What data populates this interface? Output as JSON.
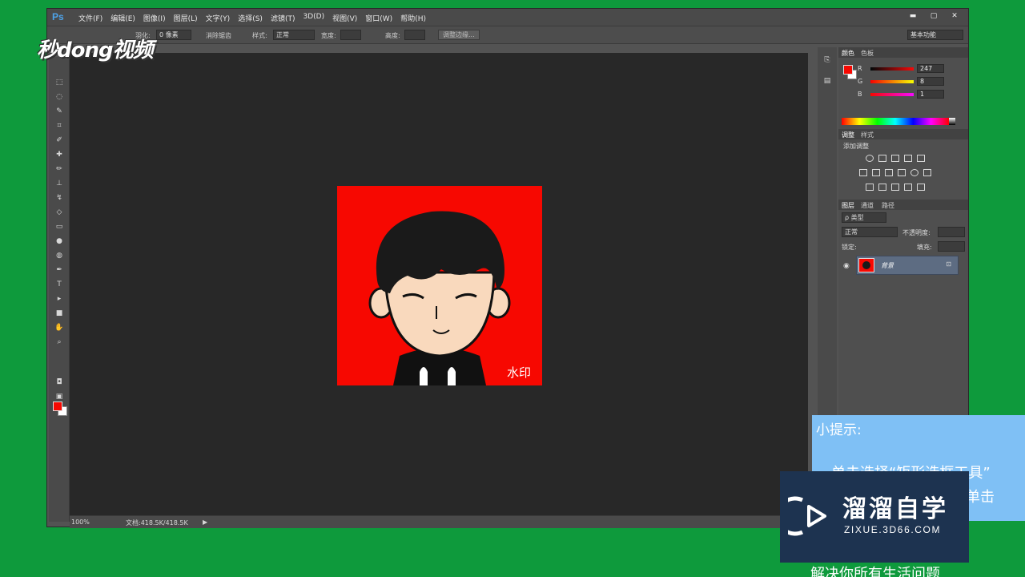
{
  "app": {
    "logo": "Ps"
  },
  "menu": [
    "文件(F)",
    "编辑(E)",
    "图像(I)",
    "图层(L)",
    "文字(Y)",
    "选择(S)",
    "滤镜(T)",
    "3D(D)",
    "视图(V)",
    "窗口(W)",
    "帮助(H)"
  ],
  "window_controls": {
    "minimize": "▬",
    "restore": "▢",
    "close": "✕"
  },
  "options_bar": {
    "feather_label": "羽化:",
    "feather_value": "0 像素",
    "antialias_label": "消除锯齿",
    "style_label": "样式:",
    "style_value": "正常",
    "width_label": "宽度:",
    "height_label": "高度:",
    "refine_edge_button": "调整边缘...",
    "workspace": "基本功能"
  },
  "status": {
    "zoom": "100%",
    "doc_info": "文档:418.5K/418.5K"
  },
  "canvas": {
    "watermark_text": "水印",
    "background_color": "#f70801"
  },
  "color_panel": {
    "tabs": [
      "颜色",
      "色板"
    ],
    "r_label": "R",
    "r_value": "247",
    "g_label": "G",
    "g_value": "8",
    "b_label": "B",
    "b_value": "1"
  },
  "adjust_panel": {
    "tabs": [
      "调整",
      "样式"
    ],
    "add_label": "添加调整"
  },
  "layers_panel": {
    "tabs": [
      "图层",
      "通道",
      "路径"
    ],
    "filter_label": "ρ 类型",
    "blend_mode": "正常",
    "opacity_label": "不透明度:",
    "lock_label": "锁定:",
    "fill_label": "填充:",
    "layer_name": "背景"
  },
  "overlay": {
    "logo_text": "秒dong视频",
    "tip_title": "小提示:",
    "tip_line1": "单击选择“矩形选框工具”",
    "tip_line2": "单击",
    "brand_name": "溜溜自学",
    "brand_url": "ZIXUE.3D66.COM",
    "bottom_caption": "解决你所有生活问题"
  }
}
